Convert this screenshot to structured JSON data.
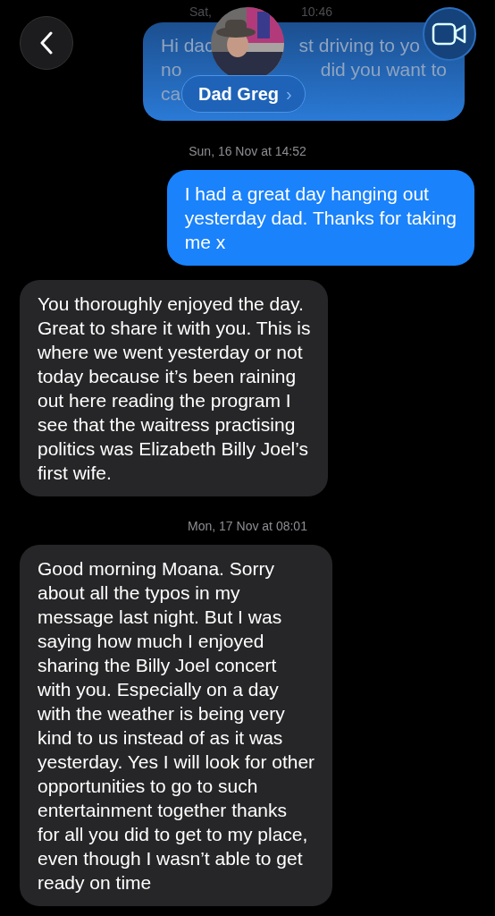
{
  "header": {
    "contact_name": "Dad Greg",
    "name_chevron": "›"
  },
  "faded_top": {
    "timestamp_parts": [
      "Sat,",
      "10:46"
    ],
    "message_rows": [
      {
        "left": "Hi dac",
        "right": "st driving to yo"
      },
      {
        "left": "no",
        "right": "did you want to"
      },
      {
        "left": "ca",
        "right": ""
      }
    ]
  },
  "messages": [
    {
      "kind": "timestamp",
      "text": "Sun, 16 Nov at 14:52"
    },
    {
      "kind": "sent",
      "lines": [
        "I had a great day hanging out",
        "yesterday dad. Thanks for taking",
        "me x"
      ]
    },
    {
      "kind": "received",
      "lines": [
        "You thoroughly enjoyed the day.",
        "Great to share it with you. This is",
        "where we went yesterday or not",
        "today because it’s been raining",
        "out here reading the program I",
        "see that the waitress practising",
        "politics was Elizabeth Billy Joel’s",
        "first wife."
      ]
    },
    {
      "kind": "timestamp",
      "text": "Mon, 17 Nov at 08:01"
    },
    {
      "kind": "received",
      "lines": [
        "Good morning Moana. Sorry",
        "about all the typos in my",
        "message last night. But I was",
        "saying how much I enjoyed",
        "sharing the Billy Joel concert",
        "with you. Especially on a day",
        "with the weather is being very",
        "kind to us instead of as it was",
        "yesterday. Yes I will look for other",
        "opportunities to go to such",
        "entertainment together thanks",
        "for all you did to get to my place,",
        "even though I wasn’t able to get",
        "ready on time"
      ]
    }
  ]
}
